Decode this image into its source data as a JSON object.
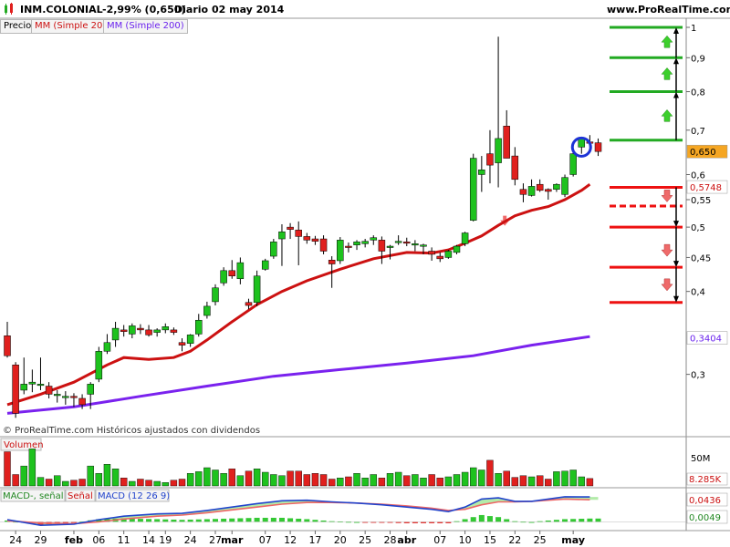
{
  "header": {
    "instrument": "INM.COLONIAL",
    "change": "-2,99% (0,650)",
    "timeframe": "Diario",
    "date": "02 may 2014",
    "site": "www.ProRealTime.com"
  },
  "legend": {
    "price": "Precio",
    "ma20": "MM (Simple 20)",
    "ma200": "MM (Simple 200)",
    "copyright": "© ProRealTime.com  Históricos ajustados con dividendos",
    "volume": "Volumen",
    "macd_signal_label": "MACD-, señal",
    "signal_label": "Señal",
    "macd_params": "MACD (12 26 9)"
  },
  "colors": {
    "up": "#1ec21e",
    "down": "#e0201e",
    "ma20": "#cc1111",
    "ma200": "#7a22ee",
    "macd_line": "#2244cc",
    "signal_line": "#ee6666",
    "fill": "#a6e89a",
    "green_level": "#22aa22",
    "red_level": "#ee1111",
    "circle": "#1d33d6"
  },
  "chart_data": [
    {
      "type": "candlestick",
      "title": "INM.COLONIAL",
      "y_axis": {
        "ylim": [
          0.255,
          1.0
        ],
        "ticks": [
          1,
          0.9,
          0.8,
          0.7,
          0.6,
          0.55,
          0.5,
          0.45,
          0.4,
          0.3
        ],
        "tick_labels": [
          "1",
          "0,9",
          "0,8",
          "0,7",
          "0,6",
          "0,55",
          "0,5",
          "0,45",
          "0,4",
          "0,3"
        ],
        "scale": "log",
        "position": "right"
      },
      "x_ticks": [
        {
          "i": 1,
          "label": "24"
        },
        {
          "i": 4,
          "label": "29"
        },
        {
          "i": 8,
          "label": "feb"
        },
        {
          "i": 11,
          "label": "06"
        },
        {
          "i": 14,
          "label": "11"
        },
        {
          "i": 17,
          "label": "14"
        },
        {
          "i": 19,
          "label": "19"
        },
        {
          "i": 22,
          "label": "24"
        },
        {
          "i": 25,
          "label": "27"
        },
        {
          "i": 27,
          "label": "mar"
        },
        {
          "i": 31,
          "label": "07"
        },
        {
          "i": 34,
          "label": "12"
        },
        {
          "i": 37,
          "label": "17"
        },
        {
          "i": 40,
          "label": "20"
        },
        {
          "i": 43,
          "label": "25"
        },
        {
          "i": 46,
          "label": "28"
        },
        {
          "i": 48,
          "label": "abr"
        },
        {
          "i": 52,
          "label": "07"
        },
        {
          "i": 55,
          "label": "10"
        },
        {
          "i": 58,
          "label": "15"
        },
        {
          "i": 61,
          "label": "22"
        },
        {
          "i": 64,
          "label": "25"
        },
        {
          "i": 68,
          "label": "may"
        }
      ],
      "candles": [
        [
          0.343,
          0.36,
          0.318,
          0.32
        ],
        [
          0.31,
          0.313,
          0.258,
          0.262
        ],
        [
          0.284,
          0.318,
          0.28,
          0.29
        ],
        [
          0.29,
          0.305,
          0.282,
          0.292
        ],
        [
          0.29,
          0.318,
          0.284,
          0.29
        ],
        [
          0.288,
          0.292,
          0.276,
          0.28
        ],
        [
          0.28,
          0.284,
          0.272,
          0.28
        ],
        [
          0.278,
          0.283,
          0.27,
          0.278
        ],
        [
          0.278,
          0.281,
          0.268,
          0.277
        ],
        [
          0.276,
          0.28,
          0.266,
          0.27
        ],
        [
          0.28,
          0.292,
          0.266,
          0.29
        ],
        [
          0.295,
          0.33,
          0.292,
          0.325
        ],
        [
          0.325,
          0.345,
          0.322,
          0.335
        ],
        [
          0.338,
          0.36,
          0.33,
          0.352
        ],
        [
          0.35,
          0.356,
          0.342,
          0.348
        ],
        [
          0.345,
          0.358,
          0.34,
          0.355
        ],
        [
          0.352,
          0.357,
          0.345,
          0.35
        ],
        [
          0.35,
          0.356,
          0.342,
          0.344
        ],
        [
          0.347,
          0.352,
          0.342,
          0.35
        ],
        [
          0.35,
          0.358,
          0.346,
          0.354
        ],
        [
          0.35,
          0.353,
          0.344,
          0.347
        ],
        [
          0.335,
          0.34,
          0.325,
          0.332
        ],
        [
          0.334,
          0.345,
          0.33,
          0.344
        ],
        [
          0.345,
          0.37,
          0.342,
          0.362
        ],
        [
          0.368,
          0.386,
          0.364,
          0.38
        ],
        [
          0.386,
          0.41,
          0.381,
          0.405
        ],
        [
          0.412,
          0.435,
          0.408,
          0.43
        ],
        [
          0.43,
          0.446,
          0.418,
          0.422
        ],
        [
          0.418,
          0.45,
          0.41,
          0.442
        ],
        [
          0.385,
          0.39,
          0.376,
          0.381
        ],
        [
          0.385,
          0.43,
          0.38,
          0.422
        ],
        [
          0.432,
          0.448,
          0.43,
          0.445
        ],
        [
          0.452,
          0.48,
          0.448,
          0.475
        ],
        [
          0.48,
          0.505,
          0.437,
          0.492
        ],
        [
          0.5,
          0.507,
          0.48,
          0.496
        ],
        [
          0.495,
          0.51,
          0.438,
          0.484
        ],
        [
          0.484,
          0.49,
          0.472,
          0.478
        ],
        [
          0.48,
          0.485,
          0.47,
          0.476
        ],
        [
          0.48,
          0.486,
          0.455,
          0.46
        ],
        [
          0.446,
          0.452,
          0.405,
          0.44
        ],
        [
          0.445,
          0.483,
          0.44,
          0.478
        ],
        [
          0.468,
          0.474,
          0.458,
          0.467
        ],
        [
          0.47,
          0.478,
          0.462,
          0.475
        ],
        [
          0.472,
          0.48,
          0.466,
          0.476
        ],
        [
          0.478,
          0.486,
          0.47,
          0.482
        ],
        [
          0.478,
          0.484,
          0.44,
          0.46
        ],
        [
          0.466,
          0.47,
          0.447,
          0.468
        ],
        [
          0.475,
          0.486,
          0.47,
          0.476
        ],
        [
          0.475,
          0.482,
          0.468,
          0.474
        ],
        [
          0.47,
          0.478,
          0.46,
          0.472
        ],
        [
          0.468,
          0.472,
          0.455,
          0.47
        ],
        [
          0.46,
          0.466,
          0.445,
          0.455
        ],
        [
          0.452,
          0.458,
          0.443,
          0.448
        ],
        [
          0.45,
          0.462,
          0.448,
          0.46
        ],
        [
          0.458,
          0.47,
          0.455,
          0.468
        ],
        [
          0.472,
          0.492,
          0.468,
          0.49
        ],
        [
          0.512,
          0.645,
          0.51,
          0.635
        ],
        [
          0.6,
          0.64,
          0.565,
          0.61
        ],
        [
          0.645,
          0.7,
          0.582,
          0.62
        ],
        [
          0.625,
          0.968,
          0.574,
          0.68
        ],
        [
          0.71,
          0.75,
          0.635,
          0.635
        ],
        [
          0.64,
          0.66,
          0.578,
          0.59
        ],
        [
          0.57,
          0.582,
          0.545,
          0.56
        ],
        [
          0.558,
          0.59,
          0.556,
          0.576
        ],
        [
          0.58,
          0.59,
          0.565,
          0.568
        ],
        [
          0.57,
          0.572,
          0.55,
          0.566
        ],
        [
          0.57,
          0.582,
          0.565,
          0.58
        ],
        [
          0.56,
          0.6,
          0.555,
          0.594
        ],
        [
          0.6,
          0.65,
          0.596,
          0.645
        ],
        [
          0.66,
          0.684,
          0.645,
          0.68
        ],
        [
          0.672,
          0.688,
          0.658,
          0.671
        ],
        [
          0.67,
          0.68,
          0.64,
          0.65
        ]
      ],
      "ma20": [
        [
          0,
          0.27
        ],
        [
          4,
          0.28
        ],
        [
          8,
          0.292
        ],
        [
          12,
          0.31
        ],
        [
          14,
          0.318
        ],
        [
          17,
          0.316
        ],
        [
          20,
          0.318
        ],
        [
          22,
          0.325
        ],
        [
          24,
          0.338
        ],
        [
          27,
          0.36
        ],
        [
          30,
          0.382
        ],
        [
          33,
          0.4
        ],
        [
          36,
          0.415
        ],
        [
          40,
          0.432
        ],
        [
          44,
          0.448
        ],
        [
          48,
          0.458
        ],
        [
          51,
          0.457
        ],
        [
          53,
          0.462
        ],
        [
          55,
          0.473
        ],
        [
          57,
          0.485
        ],
        [
          59,
          0.503
        ],
        [
          61,
          0.52
        ],
        [
          63,
          0.53
        ],
        [
          65,
          0.537
        ],
        [
          67,
          0.55
        ],
        [
          69,
          0.568
        ],
        [
          70,
          0.58
        ]
      ],
      "ma200": [
        [
          0,
          0.262
        ],
        [
          8,
          0.268
        ],
        [
          16,
          0.278
        ],
        [
          24,
          0.288
        ],
        [
          32,
          0.298
        ],
        [
          40,
          0.305
        ],
        [
          48,
          0.312
        ],
        [
          56,
          0.32
        ],
        [
          63,
          0.332
        ],
        [
          70,
          0.342
        ]
      ],
      "levels": {
        "green": [
          1.0,
          0.9,
          0.8,
          0.676
        ],
        "red_solid": [
          0.574,
          0.5,
          0.435,
          0.385
        ],
        "red_dashed": [
          0.538
        ]
      },
      "price_labels": [
        {
          "text": "0,650",
          "value": 0.65
        },
        {
          "text": "0,5748",
          "value": 0.5748
        },
        {
          "text": "0,3404",
          "value": 0.3404
        }
      ],
      "arrows": {
        "up": [
          0.95,
          0.85,
          0.735
        ],
        "down": [
          0.558,
          0.462,
          0.41
        ],
        "small_down": [
          {
            "i": 60,
            "value": 0.512
          }
        ]
      },
      "circle_at": {
        "i": 69,
        "value": 0.66
      }
    },
    {
      "type": "bar",
      "title": "Volumen",
      "ticks": [
        {
          "label": "50M",
          "value": 50
        }
      ],
      "last_value_label": "8.285K",
      "ylim": [
        0,
        80
      ],
      "values": [
        60,
        20,
        35,
        65,
        15,
        12,
        18,
        8,
        10,
        12,
        35,
        22,
        38,
        30,
        14,
        8,
        12,
        10,
        8,
        6,
        10,
        12,
        22,
        25,
        32,
        28,
        22,
        30,
        18,
        26,
        30,
        24,
        20,
        18,
        26,
        26,
        20,
        22,
        20,
        12,
        14,
        16,
        22,
        14,
        20,
        14,
        22,
        24,
        18,
        20,
        14,
        20,
        14,
        16,
        20,
        24,
        32,
        28,
        45,
        22,
        26,
        15,
        18,
        16,
        18,
        12,
        25,
        26,
        28,
        16,
        13
      ]
    },
    {
      "type": "line",
      "title": "MACD (12 26 9)",
      "ylim": [
        -0.012,
        0.055
      ],
      "tick_labels": [
        {
          "label": "0,0436",
          "value": 0.0436
        },
        {
          "label": "0,0049",
          "value": 0.0049
        }
      ],
      "macd": [
        [
          0,
          0.004
        ],
        [
          4,
          -0.006
        ],
        [
          8,
          -0.004
        ],
        [
          11,
          0.004
        ],
        [
          14,
          0.01
        ],
        [
          18,
          0.014
        ],
        [
          21,
          0.015
        ],
        [
          24,
          0.02
        ],
        [
          27,
          0.026
        ],
        [
          30,
          0.032
        ],
        [
          33,
          0.037
        ],
        [
          36,
          0.038
        ],
        [
          39,
          0.035
        ],
        [
          42,
          0.033
        ],
        [
          45,
          0.03
        ],
        [
          48,
          0.026
        ],
        [
          51,
          0.022
        ],
        [
          53,
          0.018
        ],
        [
          55,
          0.026
        ],
        [
          57,
          0.04
        ],
        [
          59,
          0.042
        ],
        [
          61,
          0.036
        ],
        [
          63,
          0.036
        ],
        [
          65,
          0.04
        ],
        [
          67,
          0.044
        ],
        [
          70,
          0.0436
        ]
      ],
      "signal": [
        [
          0,
          0.002
        ],
        [
          4,
          -0.002
        ],
        [
          8,
          -0.003
        ],
        [
          11,
          0.0
        ],
        [
          14,
          0.005
        ],
        [
          18,
          0.01
        ],
        [
          21,
          0.012
        ],
        [
          24,
          0.016
        ],
        [
          27,
          0.021
        ],
        [
          30,
          0.026
        ],
        [
          33,
          0.031
        ],
        [
          36,
          0.034
        ],
        [
          39,
          0.034
        ],
        [
          42,
          0.033
        ],
        [
          45,
          0.031
        ],
        [
          48,
          0.028
        ],
        [
          51,
          0.024
        ],
        [
          53,
          0.02
        ],
        [
          55,
          0.022
        ],
        [
          57,
          0.03
        ],
        [
          59,
          0.035
        ],
        [
          61,
          0.035
        ],
        [
          63,
          0.036
        ],
        [
          65,
          0.038
        ],
        [
          67,
          0.04
        ],
        [
          70,
          0.0387
        ]
      ],
      "histogram_last": 0.0049
    }
  ]
}
